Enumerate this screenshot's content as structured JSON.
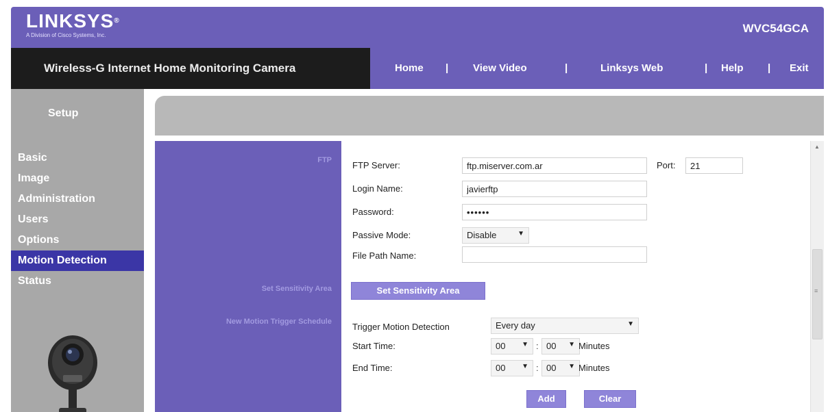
{
  "header": {
    "logo": "LINKSYS",
    "logo_sub": "A Division of Cisco Systems, Inc.",
    "model": "WVC54GCA"
  },
  "navbar": {
    "product_title": "Wireless-G Internet Home Monitoring Camera",
    "links": [
      "Home",
      "View Video",
      "Linksys Web",
      "Help",
      "Exit"
    ],
    "separator": "|"
  },
  "sidebar": {
    "section": "Setup",
    "items": [
      {
        "label": "Basic",
        "active": false
      },
      {
        "label": "Image",
        "active": false
      },
      {
        "label": "Administration",
        "active": false
      },
      {
        "label": "Users",
        "active": false
      },
      {
        "label": "Options",
        "active": false
      },
      {
        "label": "Motion Detection",
        "active": true
      },
      {
        "label": "Status",
        "active": false
      }
    ]
  },
  "labels": {
    "ftp": "FTP",
    "sensitivity": "Set Sensitivity Area",
    "schedule": "New Motion Trigger Schedule"
  },
  "ftp": {
    "server_label": "FTP Server:",
    "server_value": "ftp.miserver.com.ar",
    "port_label": "Port:",
    "port_value": "21",
    "login_label": "Login Name:",
    "login_value": "javierftp",
    "password_label": "Password:",
    "password_value": "••••••",
    "passive_label": "Passive Mode:",
    "passive_value": "Disable",
    "path_label": "File Path Name:",
    "path_value": ""
  },
  "sensitivity": {
    "button_label": "Set Sensitivity Area"
  },
  "schedule": {
    "trigger_label": "Trigger Motion Detection",
    "trigger_value": "Every day",
    "start_label": "Start Time:",
    "end_label": "End Time:",
    "start_hour": "00",
    "start_minute": "00",
    "end_hour": "00",
    "end_minute": "00",
    "minutes_label": "Minutes",
    "colon": ":",
    "add_label": "Add",
    "clear_label": "Clear"
  },
  "colors": {
    "brand_purple": "#6b5fb8",
    "active_nav": "#3b36a6",
    "button": "#8f85d9"
  },
  "icons": {
    "dropdown": "chevron-down-icon",
    "camera": "webcam-icon"
  }
}
